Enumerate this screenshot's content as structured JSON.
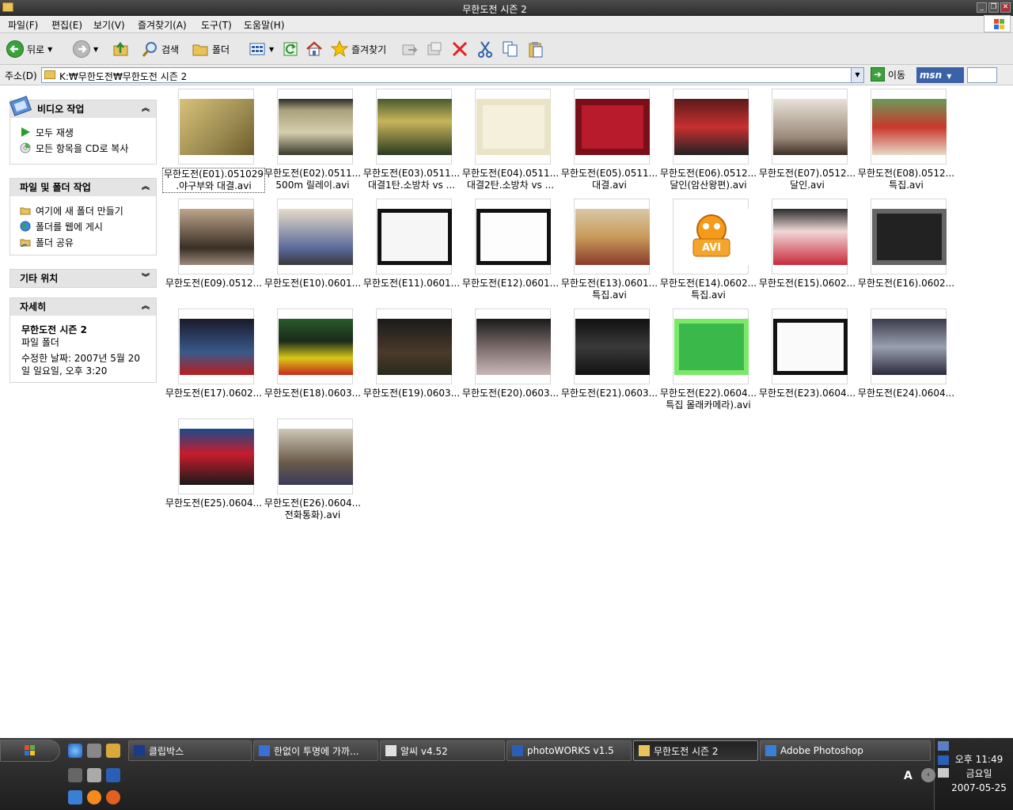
{
  "window": {
    "title": "무한도전 시즌 2"
  },
  "menu": [
    "파일(F)",
    "편집(E)",
    "보기(V)",
    "즐겨찾기(A)",
    "도구(T)",
    "도움말(H)"
  ],
  "toolbar": {
    "back_label": "뒤로",
    "search_label": "검색",
    "folders_label": "폴더",
    "favorites_label": "즐겨찾기"
  },
  "address": {
    "label": "주소(D)",
    "path": "K:₩무한도전₩무한도전 시즌 2",
    "go_label": "이동",
    "msn": "msn"
  },
  "sidebar": {
    "video_tasks": {
      "title": "비디오 작업",
      "items": [
        "모두 재생",
        "모든 항목을 CD로 복사"
      ]
    },
    "file_tasks": {
      "title": "파일 및 폴더 작업",
      "items": [
        "여기에 새 폴더 만들기",
        "폴더를 웹에 게시",
        "폴더 공유"
      ]
    },
    "other_places": {
      "title": "기타 위치"
    },
    "details": {
      "title": "자세히",
      "name": "무한도전 시즌 2",
      "type": "파일 폴더",
      "modified_1": "수정한 날짜: 2007년 5월 20",
      "modified_2": "일 일요일, 오후 3:20"
    }
  },
  "files": [
    {
      "line1": "무한도전(E01).051029",
      "line2": ".야구부와 대결.avi",
      "selected": true
    },
    {
      "line1": "무한도전(E02).0511...",
      "line2": "500m 릴레이.avi"
    },
    {
      "line1": "무한도전(E03).0511...",
      "line2": "대결1탄.소방차 vs ..."
    },
    {
      "line1": "무한도전(E04).0511...",
      "line2": "대결2탄.소방차 vs ..."
    },
    {
      "line1": "무한도전(E05).0511...",
      "line2": "대결.avi"
    },
    {
      "line1": "무한도전(E06).0512...",
      "line2": "달인(암산왕편).avi"
    },
    {
      "line1": "무한도전(E07).0512...",
      "line2": "달인.avi"
    },
    {
      "line1": "무한도전(E08).0512...",
      "line2": "특집.avi"
    },
    {
      "line1": "무한도전(E09).0512...",
      "line2": ""
    },
    {
      "line1": "무한도전(E10).0601...",
      "line2": ""
    },
    {
      "line1": "무한도전(E11).0601...",
      "line2": ""
    },
    {
      "line1": "무한도전(E12).0601...",
      "line2": ""
    },
    {
      "line1": "무한도전(E13).0601...",
      "line2": "특집.avi"
    },
    {
      "line1": "무한도전(E14).0602...",
      "line2": "특집.avi",
      "avi_icon": "AVI"
    },
    {
      "line1": "무한도전(E15).0602...",
      "line2": ""
    },
    {
      "line1": "무한도전(E16).0602...",
      "line2": ""
    },
    {
      "line1": "무한도전(E17).0602...",
      "line2": ""
    },
    {
      "line1": "무한도전(E18).0603...",
      "line2": ""
    },
    {
      "line1": "무한도전(E19).0603...",
      "line2": ""
    },
    {
      "line1": "무한도전(E20).0603...",
      "line2": ""
    },
    {
      "line1": "무한도전(E21).0603...",
      "line2": ""
    },
    {
      "line1": "무한도전(E22).0604...",
      "line2": "특집 몰래카메라).avi"
    },
    {
      "line1": "무한도전(E23).0604...",
      "line2": ""
    },
    {
      "line1": "무한도전(E24).0604...",
      "line2": ""
    },
    {
      "line1": "무한도전(E25).0604...",
      "line2": ""
    },
    {
      "line1": "무한도전(E26).0604...",
      "line2": "전화통화).avi"
    }
  ],
  "taskbar": {
    "buttons": [
      "클립박스",
      "한없이 투명에 가까...",
      "알씨 v4.52",
      "photoWORKS v1.5",
      "무한도전 시즌 2",
      "Adobe Photoshop"
    ],
    "active_index": 4,
    "tray_letter": "A",
    "clock_time": "오후 11:49",
    "clock_day": "금요일",
    "clock_date": "2007-05-25"
  }
}
